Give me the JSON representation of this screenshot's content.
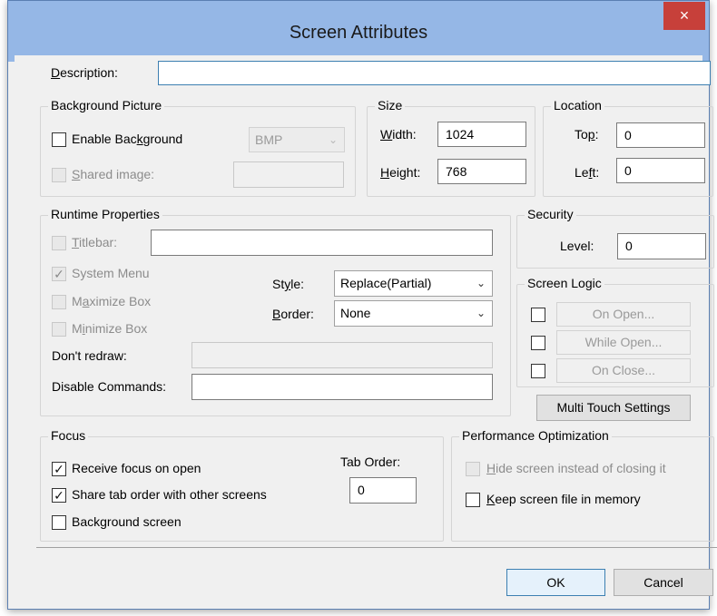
{
  "window": {
    "title": "Screen Attributes",
    "close_icon": "×"
  },
  "description": {
    "label_pre": "",
    "label_u": "D",
    "label_post": "escription:",
    "value": ""
  },
  "background_picture": {
    "legend": "Background Picture",
    "enable_pre": "Enable Bac",
    "enable_u": "k",
    "enable_post": "ground",
    "enable_checked": false,
    "format": "BMP",
    "shared_pre": "",
    "shared_u": "S",
    "shared_post": "hared image:",
    "shared_checked": false,
    "shared_value": ""
  },
  "size": {
    "legend": "Size",
    "width_pre": "",
    "width_u": "W",
    "width_post": "idth:",
    "width": "1024",
    "height_pre": "",
    "height_u": "H",
    "height_post": "eight:",
    "height": "768"
  },
  "location": {
    "legend": "Location",
    "top_pre": "To",
    "top_u": "p",
    "top_post": ":",
    "top": "0",
    "left_pre": "Le",
    "left_u": "f",
    "left_post": "t:",
    "left": "0"
  },
  "runtime": {
    "legend": "Runtime Properties",
    "titlebar_pre": "",
    "titlebar_u": "T",
    "titlebar_post": "itlebar:",
    "titlebar_value": "",
    "sysmenu_pre": "System Me",
    "sysmenu_u": "",
    "sysmenu_post": "nu",
    "sysmenu_checked": true,
    "maximize_pre": "M",
    "maximize_u": "a",
    "maximize_post": "ximize Box",
    "minimize_pre": "M",
    "minimize_u": "i",
    "minimize_post": "nimize Box",
    "style_pre": "St",
    "style_u": "y",
    "style_post": "le:",
    "style_value": "Replace(Partial)",
    "border_pre": "",
    "border_u": "B",
    "border_post": "order:",
    "border_value": "None",
    "dont_redraw": "Don't redraw:",
    "dont_redraw_value": "",
    "disable_commands": "Disable Commands:",
    "disable_commands_value": ""
  },
  "security": {
    "legend": "Security",
    "level_label": "Level:",
    "level": "0"
  },
  "screen_logic": {
    "legend": "Screen Logic",
    "on_open": "On Open...",
    "while_open": "While Open...",
    "on_close": "On Close..."
  },
  "multi_touch": "Multi Touch Settings",
  "focus": {
    "legend": "Focus",
    "receive": "Receive focus on open",
    "receive_checked": true,
    "share": "Share tab order with other screens",
    "share_checked": true,
    "background": "Background screen",
    "background_checked": false,
    "tab_order_label": "Tab Order:",
    "tab_order": "0"
  },
  "performance": {
    "legend": "Performance Optimization",
    "hide_pre": "",
    "hide_u": "H",
    "hide_post": "ide screen instead of closing it",
    "keep_pre": "",
    "keep_u": "K",
    "keep_post": "eep screen file in memory",
    "keep_checked": false
  },
  "buttons": {
    "ok": "OK",
    "cancel": "Cancel"
  },
  "colors": {
    "titlebar": "#95b7e6",
    "close": "#c7403a",
    "dialog": "#f0f0f0"
  }
}
